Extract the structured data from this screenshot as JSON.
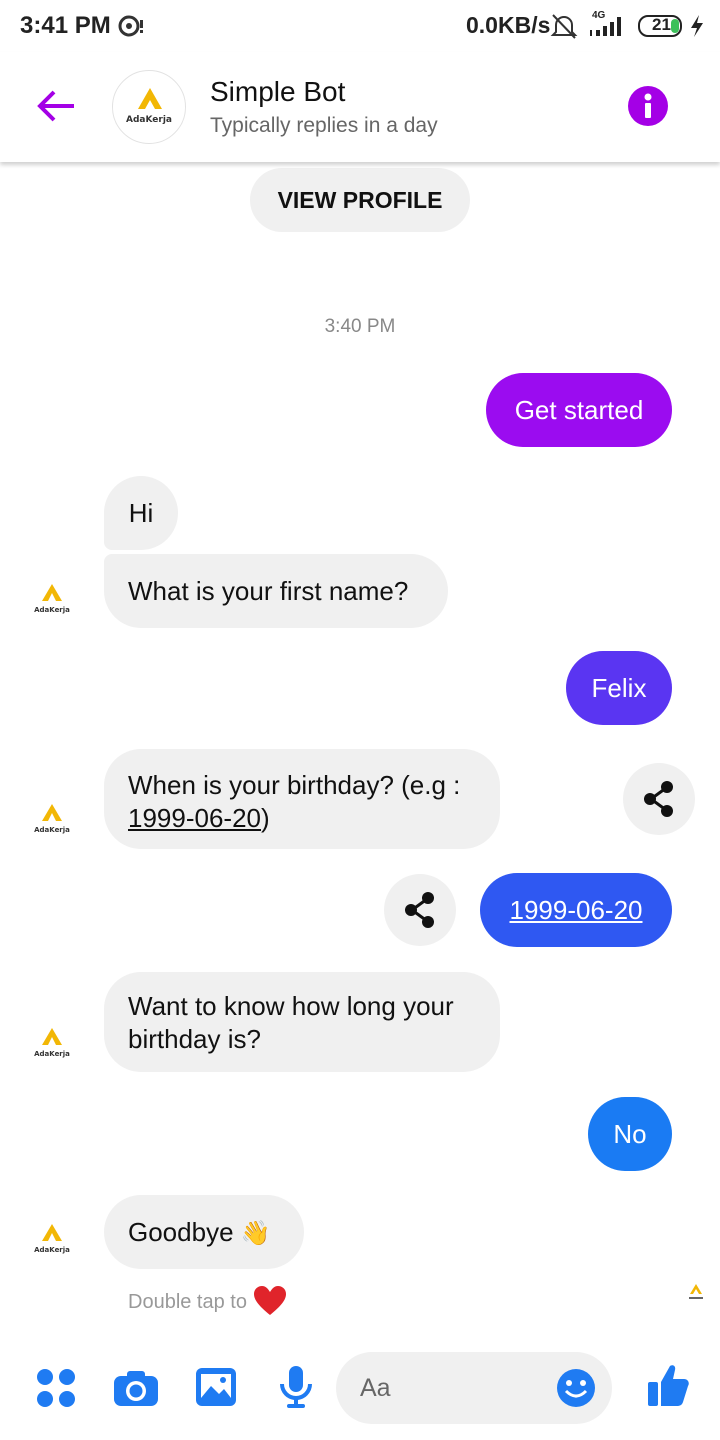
{
  "status_bar": {
    "time": "3:41 PM",
    "network_speed": "0.0KB/s",
    "signal_label": "4G",
    "battery": "21"
  },
  "header": {
    "title": "Simple Bot",
    "subtitle": "Typically replies in a day",
    "logo_text": "AdaKerja",
    "back_icon": "arrow-left-icon",
    "info_icon": "info-icon"
  },
  "chat": {
    "view_profile": "VIEW PROFILE",
    "timestamp": "3:40 PM",
    "messages": {
      "get_started": "Get started",
      "hi": "Hi",
      "first_name_q": "What is your first name?",
      "felix": "Felix",
      "birthday_q_line1": "When is your birthday? (e.g :",
      "birthday_q_line2_link": "1999-06-20",
      "birthday_q_line2_tail": ")",
      "birthday_answer": "1999-06-20",
      "how_long_line1": "Want to know how long your",
      "how_long_line2": "birthday is?",
      "no": "No",
      "goodbye": "Goodbye",
      "goodbye_emoji": "👋"
    },
    "hint": "Double tap to",
    "hint_emoji": "❤️",
    "colors": {
      "get_started": "#9b0cf0",
      "felix": "#5a35f2",
      "birthday": "#2f58f2",
      "no": "#1a7bf3",
      "accent_purple": "#a400e6",
      "composer_blue": "#1f7bf2"
    }
  },
  "composer": {
    "placeholder": "Aa",
    "icons": [
      "apps-icon",
      "camera-icon",
      "gallery-icon",
      "mic-icon",
      "emoji-icon",
      "thumbs-up-icon"
    ]
  }
}
